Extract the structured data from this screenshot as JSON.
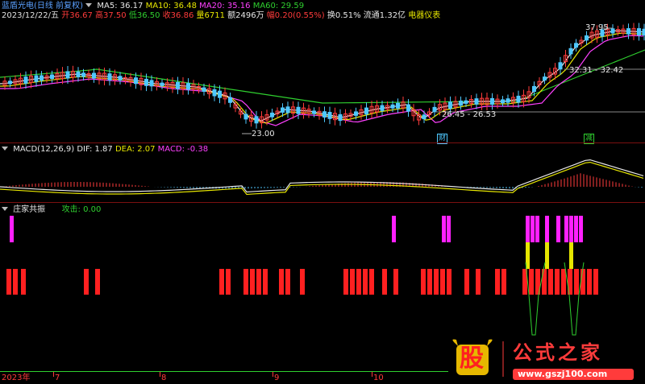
{
  "header": {
    "title": "蓝盾光电(日线 前复权)",
    "ma5": "MA5: 36.17",
    "ma10": "MA10: 36.48",
    "ma20": "MA20: 35.16",
    "ma60": "MA60: 29.59",
    "date": "2023/12/22/五",
    "open": "开36.67",
    "high": "高37.50",
    "low": "低36.50",
    "close": "收36.86",
    "volume": "量6711",
    "amount": "额2496万",
    "change": "幅0.20(0.55%)",
    "turnover": "换0.51%",
    "float": "流通1.32亿",
    "sector": "电器仪表"
  },
  "price_annotations": {
    "high_label": "37.95",
    "low_label": "23.00",
    "range1": "26.45 - 26.53",
    "range2": "32.31 - 32.42",
    "badge_cai": "财",
    "badge_jian": "减"
  },
  "macd": {
    "title": "MACD(12,26,9)",
    "dif": "DIF: 1.87",
    "dea": "DEA: 2.07",
    "macd": "MACD: -0.38"
  },
  "indicator": {
    "title": "庄家共振",
    "attack": "攻击: 0.00"
  },
  "time_axis": {
    "labels": [
      "2023年",
      "7",
      "8",
      "9",
      "10"
    ]
  },
  "watermark": {
    "logo_char": "股",
    "text": "公式之家",
    "url": "www.gszj100.com"
  },
  "colors": {
    "up": "#ff3b3b",
    "down": "#2fcf2f",
    "ma5": "#e8e8e8",
    "ma10": "#e6e600",
    "ma20": "#ff40ff",
    "ma60": "#2fcf2f",
    "bg": "#000000"
  }
}
